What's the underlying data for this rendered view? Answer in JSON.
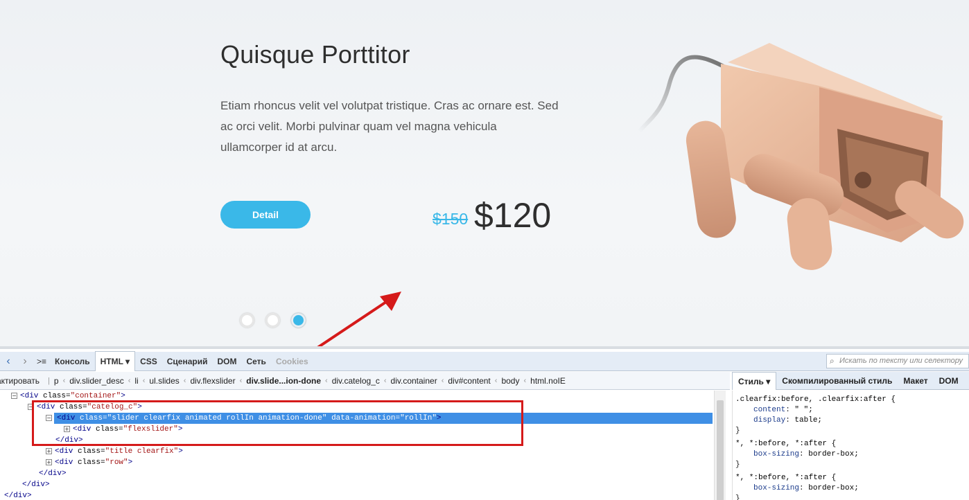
{
  "slide": {
    "title": "Quisque Porttitor",
    "description": "Etiam rhoncus velit vel volutpat tristique. Cras ac ornare est. Sed ac orci velit. Morbi pulvinar quam vel magna vehicula ullamcorper id at arcu.",
    "detail_label": "Detail",
    "old_price": "$150",
    "new_price": "$120",
    "dots_count": 3,
    "active_dot": 3
  },
  "devtools": {
    "tabs": [
      "Консоль",
      "HTML ▾",
      "CSS",
      "Сценарий",
      "DOM",
      "Сеть",
      "Cookies"
    ],
    "active_tab": "HTML ▾",
    "search_placeholder": "Искать по тексту или селектору",
    "edit_label": "дактировать",
    "breadcrumbs": [
      "p",
      "div.slider_desc",
      "li",
      "ul.slides",
      "div.flexslider",
      "div.slide...ion-done",
      "div.catelog_c",
      "div.container",
      "div#content",
      "body",
      "html.noIE"
    ],
    "side_tabs": [
      "Стиль ▾",
      "Скомпилированный стиль",
      "Макет",
      "DOM"
    ],
    "tree": [
      {
        "tag": "div",
        "attrs": [
          {
            "n": "class",
            "v": "container"
          }
        ],
        "toggle": "−",
        "close": false
      },
      {
        "tag": "div",
        "attrs": [
          {
            "n": "class",
            "v": "catelog_c"
          }
        ],
        "toggle": "−",
        "close": false
      },
      {
        "tag": "div",
        "attrs": [
          {
            "n": "class",
            "v": "slider clearfix animated rollIn animation-done"
          },
          {
            "n": "data-animation",
            "v": "rollIn"
          }
        ],
        "toggle": "−",
        "close": false
      },
      {
        "tag": "div",
        "attrs": [
          {
            "n": "class",
            "v": "flexslider"
          }
        ],
        "toggle": "+",
        "close": false
      },
      {
        "text": "</div>"
      },
      {
        "tag": "div",
        "attrs": [
          {
            "n": "class",
            "v": "title clearfix"
          }
        ],
        "toggle": "+",
        "close": false
      },
      {
        "tag": "div",
        "attrs": [
          {
            "n": "class",
            "v": "row"
          }
        ],
        "toggle": "+",
        "close": false
      },
      {
        "text": "</div>"
      },
      {
        "text": "</div>"
      },
      {
        "text": "</div>"
      }
    ],
    "css_rules": [
      {
        "selector": ".clearfix:before, .clearfix:after {",
        "props": [
          {
            "n": "content",
            "v": "\" \";"
          },
          {
            "n": "display",
            "v": "table;"
          }
        ]
      },
      {
        "selector": "*, *:before, *:after {",
        "props": [
          {
            "n": "box-sizing",
            "v": "border-box;"
          }
        ]
      },
      {
        "selector": "*, *:before, *:after {",
        "props": [
          {
            "n": "box-sizing",
            "v": "border-box;"
          }
        ]
      }
    ]
  },
  "colors": {
    "accent": "#3ab8e8",
    "annotation": "#d51a1a",
    "selection": "#3f8fe5"
  }
}
